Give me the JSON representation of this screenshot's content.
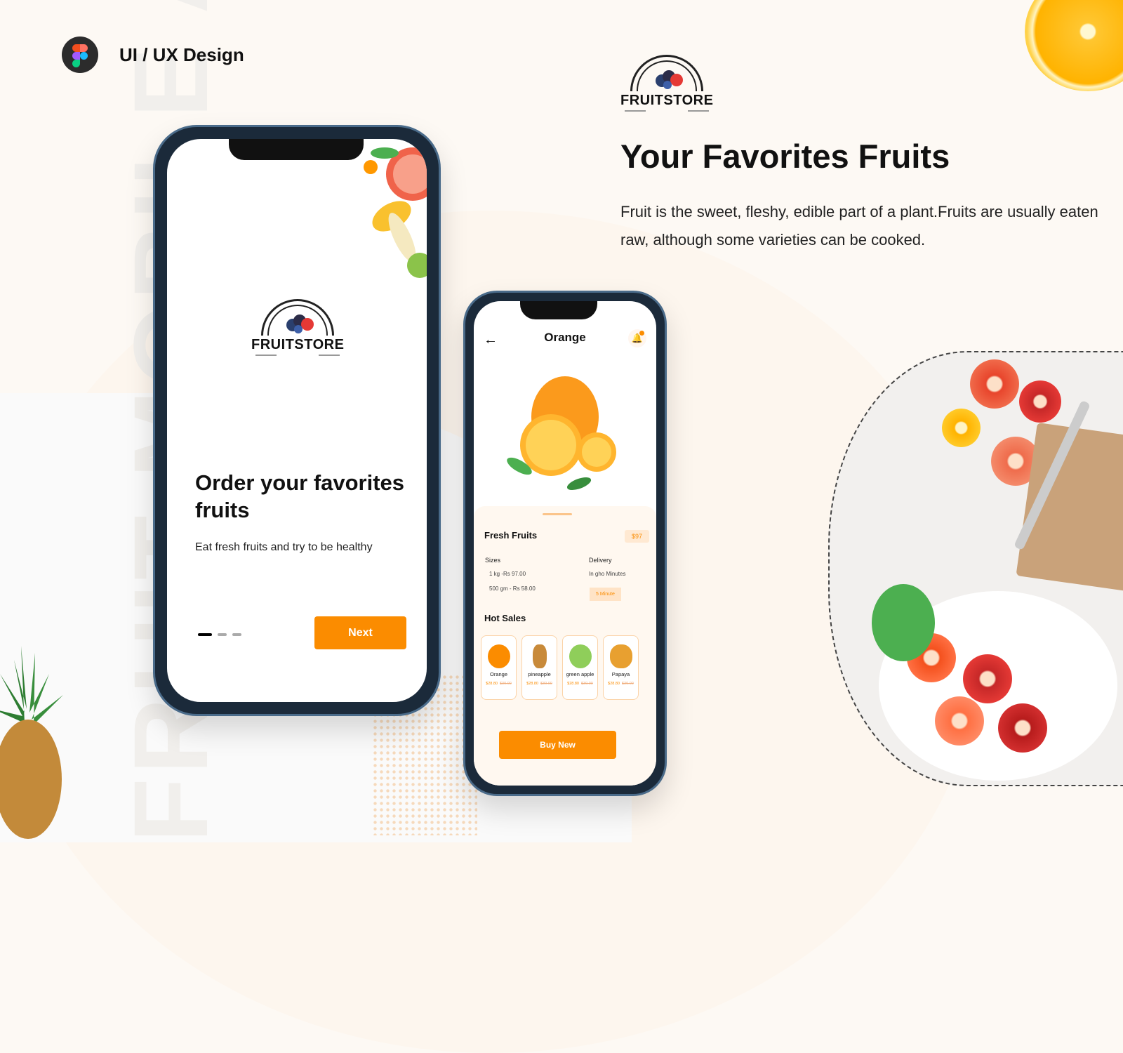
{
  "brand": {
    "icon": "figma-icon",
    "title": "UI / UX Design"
  },
  "watermark": "FRUIT MOBILE APP",
  "logo": {
    "text": "FRUITSTORE",
    "icon": "berries-arch-icon"
  },
  "hero": {
    "headline": "Your Favorites Fruits",
    "description": "Fruit is the sweet, fleshy, edible part of a plant.Fruits are usually eaten raw, although some varieties can be cooked."
  },
  "onboarding_screen": {
    "headline": "Order your favorites fruits",
    "subtitle": "Eat fresh fruits and try to be healthy",
    "pager": {
      "total": 3,
      "active": 1
    },
    "next_label": "Next"
  },
  "product_screen": {
    "title": "Orange",
    "back_icon": "arrow-left-icon",
    "bell_icon": "bell-icon",
    "section_title": "Fresh Fruits",
    "price": "$97",
    "sizes_label": "Sizes",
    "sizes": [
      "1 kg -Rs 97.00",
      "500 gm - Rs 58.00"
    ],
    "delivery_label": "Delivery",
    "delivery_text": "In gho Minutes",
    "delivery_tag": "5 Minute",
    "hot_sales_title": "Hot Sales",
    "hot_sales": [
      {
        "name": "Orange",
        "price": "$28.80",
        "old_price": "$30.00",
        "color": "#fb8c00"
      },
      {
        "name": "pineapple",
        "price": "$28.80",
        "old_price": "$30.00",
        "color": "#c88a3a"
      },
      {
        "name": "green apple",
        "price": "$28.80",
        "old_price": "$30.00",
        "color": "#8fce5a"
      },
      {
        "name": "Papaya",
        "price": "$28.80",
        "old_price": "$30.00",
        "color": "#e8a030"
      }
    ],
    "buy_label": "Buy New"
  },
  "colors": {
    "accent": "#fb8c00",
    "background": "#fdf9f4",
    "sheet": "#fff8f0"
  }
}
